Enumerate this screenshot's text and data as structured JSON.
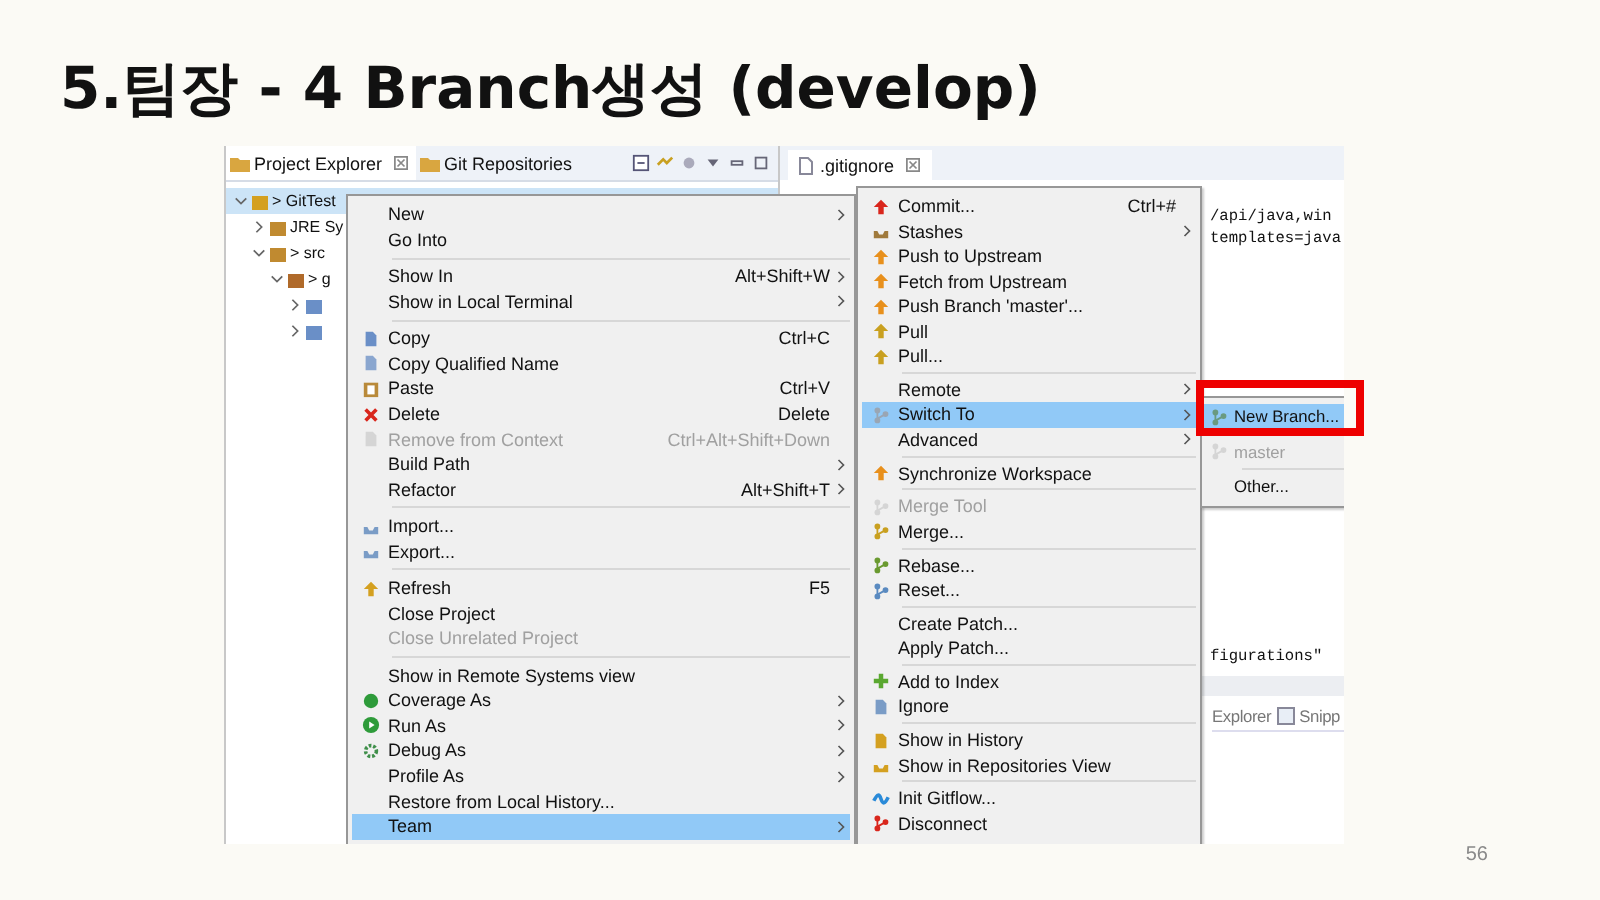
{
  "slide": {
    "title": "5.팀장 - 4 Branch생성 (develop)",
    "page_number": "56"
  },
  "views": {
    "tabs": [
      {
        "label": "Project Explorer",
        "selected": true
      },
      {
        "label": "Git Repositories",
        "selected": false
      }
    ]
  },
  "tree": [
    {
      "label": "> GitTest",
      "selected": true,
      "expanded": true,
      "children": [
        {
          "label": "JRE Sy",
          "selected": false,
          "expanded": false
        },
        {
          "label": "> src",
          "selected": false,
          "expanded": true,
          "children": [
            {
              "label": "> g",
              "selected": false,
              "expanded": true,
              "children": [
                {
                  "selected": false,
                  "expanded": false
                },
                {
                  "selected": false,
                  "expanded": false
                }
              ]
            }
          ]
        }
      ]
    }
  ],
  "editor": {
    "tab": ".gitignore",
    "code_blocks": [
      [
        "/api/java,win",
        "templates=java"
      ],
      [
        "figurations\""
      ]
    ],
    "bottom_tabs": [
      "Explorer",
      "Snipp"
    ]
  },
  "menus": [
    {
      "groups": [
        [
          {
            "label": "New",
            "submenu": true,
            "disabled": false,
            "selected": false
          },
          {
            "label": "Go Into",
            "submenu": false,
            "disabled": false,
            "selected": false
          }
        ],
        [
          {
            "label": "Show In",
            "shortcut": "Alt+Shift+W",
            "submenu": true,
            "disabled": false,
            "selected": false
          },
          {
            "label": "Show in Local Terminal",
            "submenu": true,
            "disabled": false,
            "selected": false
          }
        ],
        [
          {
            "label": "Copy",
            "shortcut": "Ctrl+C",
            "submenu": false,
            "disabled": false,
            "selected": false
          },
          {
            "label": "Copy Qualified Name",
            "submenu": false,
            "disabled": false,
            "selected": false
          },
          {
            "label": "Paste",
            "shortcut": "Ctrl+V",
            "submenu": false,
            "disabled": false,
            "selected": false
          },
          {
            "label": "Delete",
            "shortcut": "Delete",
            "submenu": false,
            "disabled": false,
            "selected": false
          },
          {
            "label": "Remove from Context",
            "shortcut": "Ctrl+Alt+Shift+Down",
            "submenu": false,
            "disabled": true,
            "selected": false
          },
          {
            "label": "Build Path",
            "submenu": true,
            "disabled": false,
            "selected": false
          },
          {
            "label": "Refactor",
            "shortcut": "Alt+Shift+T",
            "submenu": true,
            "disabled": false,
            "selected": false
          }
        ],
        [
          {
            "label": "Import...",
            "submenu": false,
            "disabled": false,
            "selected": false
          },
          {
            "label": "Export...",
            "submenu": false,
            "disabled": false,
            "selected": false
          }
        ],
        [
          {
            "label": "Refresh",
            "shortcut": "F5",
            "submenu": false,
            "disabled": false,
            "selected": false
          },
          {
            "label": "Close Project",
            "submenu": false,
            "disabled": false,
            "selected": false
          },
          {
            "label": "Close Unrelated Project",
            "submenu": false,
            "disabled": true,
            "selected": false
          }
        ],
        [
          {
            "label": "Show in Remote Systems view",
            "submenu": false,
            "disabled": false,
            "selected": false
          },
          {
            "label": "Coverage As",
            "submenu": true,
            "disabled": false,
            "selected": false
          },
          {
            "label": "Run As",
            "submenu": true,
            "disabled": false,
            "selected": false
          },
          {
            "label": "Debug As",
            "submenu": true,
            "disabled": false,
            "selected": false
          },
          {
            "label": "Profile As",
            "submenu": true,
            "disabled": false,
            "selected": false
          },
          {
            "label": "Restore from Local History...",
            "submenu": false,
            "disabled": false,
            "selected": false
          },
          {
            "label": "Team",
            "submenu": true,
            "disabled": false,
            "selected": true
          }
        ]
      ]
    },
    {
      "groups": [
        [
          {
            "label": "Commit...",
            "shortcut": "Ctrl+#",
            "submenu": false,
            "disabled": false,
            "selected": false
          },
          {
            "label": "Stashes",
            "submenu": true,
            "disabled": false,
            "selected": false
          },
          {
            "label": "Push to Upstream",
            "submenu": false,
            "disabled": false,
            "selected": false
          },
          {
            "label": "Fetch from Upstream",
            "submenu": false,
            "disabled": false,
            "selected": false
          },
          {
            "label": "Push Branch 'master'...",
            "submenu": false,
            "disabled": false,
            "selected": false
          },
          {
            "label": "Pull",
            "submenu": false,
            "disabled": false,
            "selected": false
          },
          {
            "label": "Pull...",
            "submenu": false,
            "disabled": false,
            "selected": false
          }
        ],
        [
          {
            "label": "Remote",
            "submenu": true,
            "disabled": false,
            "selected": false
          },
          {
            "label": "Switch To",
            "submenu": true,
            "disabled": false,
            "selected": true
          },
          {
            "label": "Advanced",
            "submenu": true,
            "disabled": false,
            "selected": false
          }
        ],
        [
          {
            "label": "Synchronize Workspace",
            "submenu": false,
            "disabled": false,
            "selected": false
          }
        ],
        [
          {
            "label": "Merge Tool",
            "submenu": false,
            "disabled": true,
            "selected": false
          },
          {
            "label": "Merge...",
            "submenu": false,
            "disabled": false,
            "selected": false
          }
        ],
        [
          {
            "label": "Rebase...",
            "submenu": false,
            "disabled": false,
            "selected": false
          },
          {
            "label": "Reset...",
            "submenu": false,
            "disabled": false,
            "selected": false
          }
        ],
        [
          {
            "label": "Create Patch...",
            "submenu": false,
            "disabled": false,
            "selected": false
          },
          {
            "label": "Apply Patch...",
            "submenu": false,
            "disabled": false,
            "selected": false
          }
        ],
        [
          {
            "label": "Add to Index",
            "submenu": false,
            "disabled": false,
            "selected": false
          },
          {
            "label": "Ignore",
            "submenu": false,
            "disabled": false,
            "selected": false
          }
        ],
        [
          {
            "label": "Show in History",
            "submenu": false,
            "disabled": false,
            "selected": false
          },
          {
            "label": "Show in Repositories View",
            "submenu": false,
            "disabled": false,
            "selected": false
          }
        ],
        [
          {
            "label": "Init Gitflow...",
            "submenu": false,
            "disabled": false,
            "selected": false
          },
          {
            "label": "Disconnect",
            "submenu": false,
            "disabled": false,
            "selected": false
          }
        ]
      ]
    },
    {
      "groups": [
        [
          {
            "label": "New Branch...",
            "disabled": false,
            "selected": true
          }
        ],
        [
          {
            "label": "master",
            "disabled": true,
            "selected": false
          }
        ],
        [
          {
            "label": "Other...",
            "disabled": false,
            "selected": false
          }
        ]
      ]
    }
  ]
}
